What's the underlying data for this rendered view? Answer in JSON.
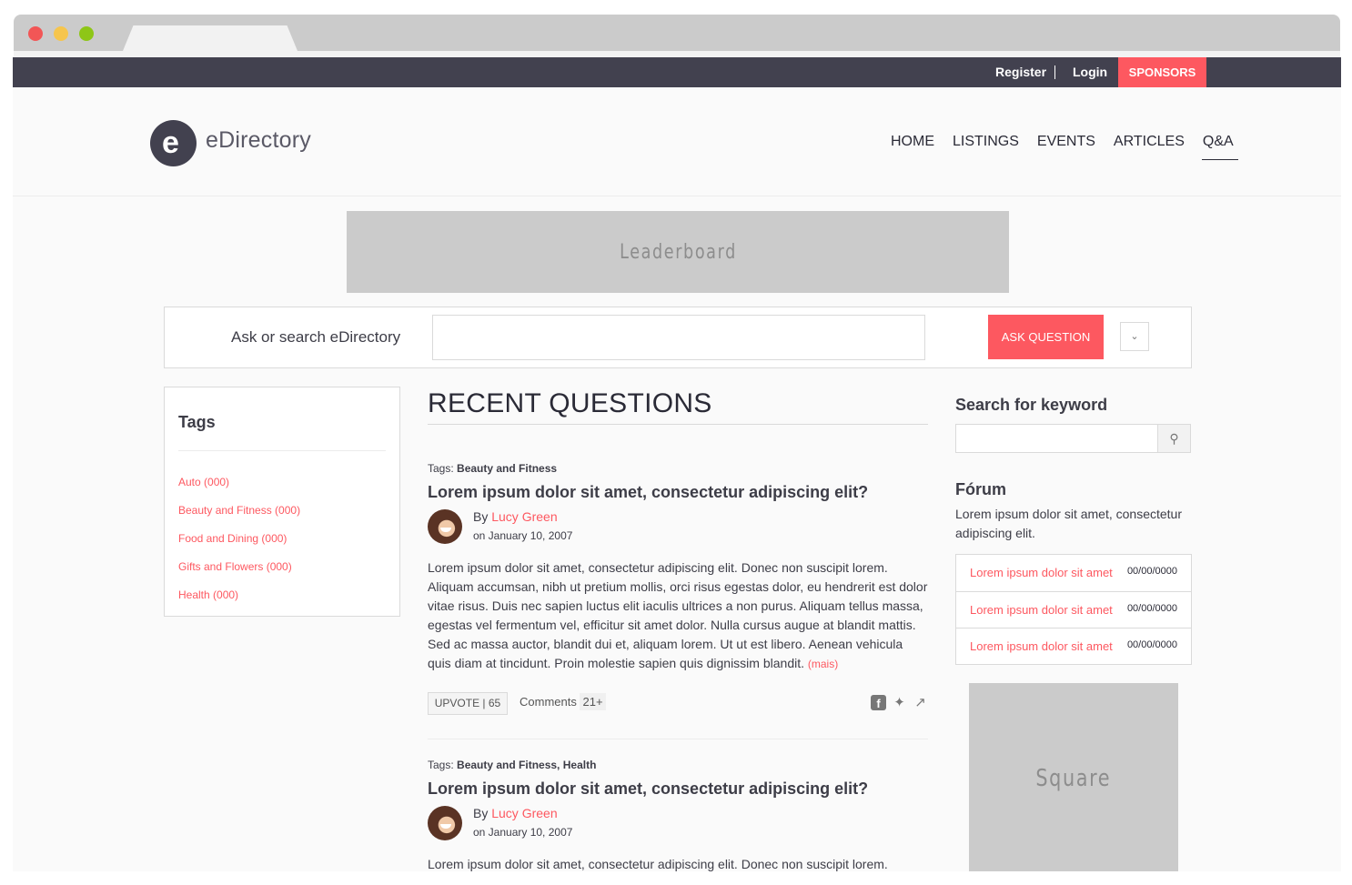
{
  "topbar": {
    "register": "Register",
    "login": "Login",
    "sponsors": "SPONSORS"
  },
  "brand": {
    "logo_letter": "e",
    "name": "eDirectory"
  },
  "nav": [
    {
      "label": "HOME",
      "active": false
    },
    {
      "label": "LISTINGS",
      "active": false
    },
    {
      "label": "EVENTS",
      "active": false
    },
    {
      "label": "ARTICLES",
      "active": false
    },
    {
      "label": "Q&A",
      "active": true
    }
  ],
  "ads": {
    "leaderboard": "Leaderboard",
    "square": "Square"
  },
  "askbar": {
    "label": "Ask or search eDirectory",
    "input_value": "",
    "button": "ASK QUESTION",
    "dropdown_icon": "chevron-down"
  },
  "tags": {
    "title": "Tags",
    "items": [
      "Auto (000)",
      "Beauty and Fitness (000)",
      "Food and Dining (000)",
      "Gifts and Flowers (000)",
      "Health (000)"
    ]
  },
  "main": {
    "title": "RECENT QUESTIONS",
    "questions": [
      {
        "tags_prefix": "Tags:",
        "tags": "Beauty and Fitness",
        "title": "Lorem ipsum dolor sit amet, consectetur adipiscing elit?",
        "by_prefix": "By",
        "author": "Lucy Green",
        "date": "on January 10, 2007",
        "body": "Lorem ipsum dolor sit amet, consectetur adipiscing elit. Donec non suscipit lorem. Aliquam accumsan, nibh ut pretium mollis, orci risus egestas dolor, eu hendrerit est dolor vitae risus. Duis nec sapien luctus elit iaculis ultrices a non purus. Aliquam tellus massa, egestas vel fermentum vel, efficitur sit amet dolor. Nulla cursus augue at blandit mattis. Sed ac massa auctor, blandit dui et, aliquam lorem. Ut ut est libero. Aenean vehicula quis diam at tincidunt. Proin molestie sapien quis dignissim blandit.",
        "more": "(mais)",
        "upvote": "UPVOTE | 65",
        "comments_label": "Comments",
        "comments_count": "21+"
      },
      {
        "tags_prefix": "Tags:",
        "tags": "Beauty and Fitness, Health",
        "title": "Lorem ipsum dolor sit amet, consectetur adipiscing elit?",
        "by_prefix": "By",
        "author": "Lucy Green",
        "date": "on January 10, 2007",
        "body": "Lorem ipsum dolor sit amet, consectetur adipiscing elit. Donec non suscipit lorem."
      }
    ]
  },
  "sidebar": {
    "search_title": "Search for keyword",
    "search_value": "",
    "forum_title": "Fórum",
    "forum_desc": "Lorem ipsum dolor sit amet, consectetur adipiscing elit.",
    "forum_items": [
      {
        "title": "Lorem ipsum dolor sit amet",
        "date": "00/00/0000"
      },
      {
        "title": "Lorem ipsum dolor sit amet",
        "date": "00/00/0000"
      },
      {
        "title": "Lorem ipsum dolor sit amet",
        "date": "00/00/0000"
      }
    ]
  },
  "colors": {
    "accent": "#fd5860",
    "topbar": "#42414f",
    "ad_placeholder": "#cbcbcb"
  }
}
